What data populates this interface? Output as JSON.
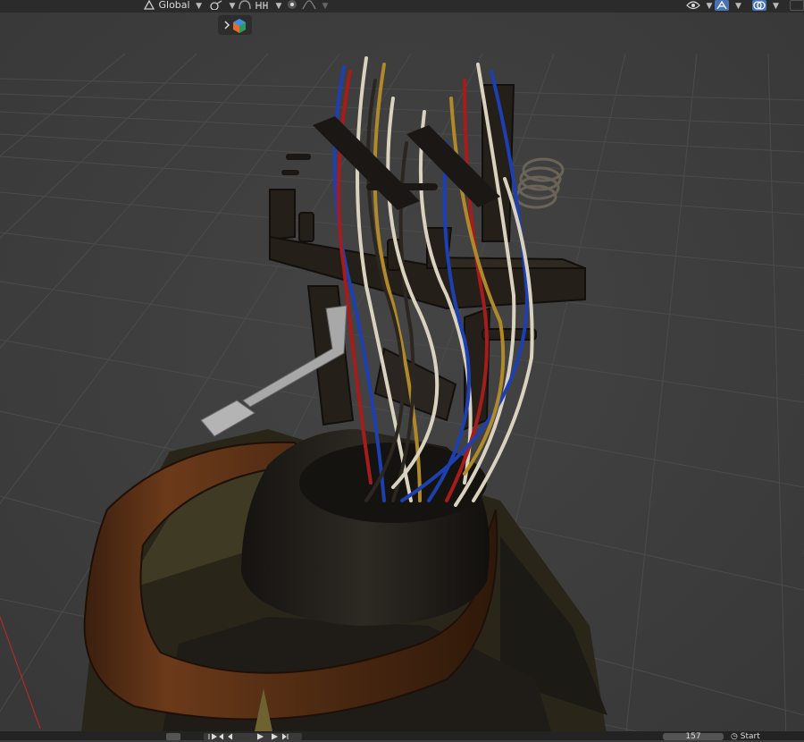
{
  "header": {
    "transform_orientation": "Global"
  },
  "timeline": {
    "current_frame": "157",
    "playback_label": "Start"
  },
  "icons": [
    "transform-orientation-icon",
    "snap-icon",
    "snap-target-icon",
    "proportional-editing-icon",
    "visibility-icon",
    "gizmo-icon",
    "overlay-icon",
    "expand-arrow-icon",
    "object-icon"
  ],
  "colors": {
    "background": "#3d3d3d",
    "grid": "#4a4a4a",
    "header": "#2b2b2b",
    "accent": "#4772b3",
    "wire_blue": "#1e3fb0",
    "wire_red": "#a51c1c",
    "wire_white": "#d9d2bf",
    "wire_yellow": "#b08a2a",
    "frame_dark": "#1e1a16",
    "leather": "#5a3218"
  }
}
